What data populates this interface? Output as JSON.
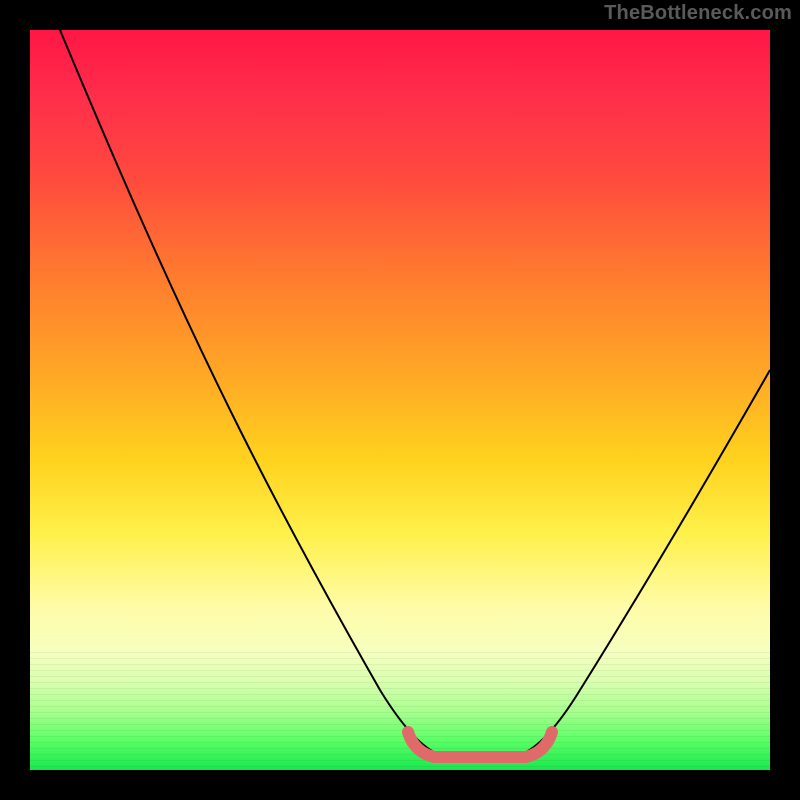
{
  "watermark": "TheBottleneck.com",
  "chart_data": {
    "type": "line",
    "title": "",
    "xlabel": "",
    "ylabel": "",
    "xlim": [
      0,
      100
    ],
    "ylim": [
      0,
      100
    ],
    "legend": false,
    "grid": false,
    "background_gradient": {
      "direction": "vertical",
      "stops": [
        {
          "pos": 0.0,
          "color": "#ff1744"
        },
        {
          "pos": 0.2,
          "color": "#ff4a3e"
        },
        {
          "pos": 0.46,
          "color": "#ffa626"
        },
        {
          "pos": 0.68,
          "color": "#fff04a"
        },
        {
          "pos": 0.88,
          "color": "#d9ffb0"
        },
        {
          "pos": 1.0,
          "color": "#18e84e"
        }
      ]
    },
    "series": [
      {
        "name": "bottleneck-curve",
        "color": "#000000",
        "stroke_width": 2,
        "x": [
          4,
          10,
          18,
          26,
          34,
          42,
          48,
          52,
          55,
          58,
          62,
          66,
          70,
          76,
          84,
          92,
          100
        ],
        "y": [
          100,
          88,
          74,
          60,
          46,
          32,
          18,
          8,
          3,
          1,
          1,
          3,
          8,
          18,
          32,
          46,
          60
        ]
      },
      {
        "name": "flat-zone-marker",
        "color": "#e06a6a",
        "stroke_width": 10,
        "notes": "thick salmon segment at the valley floor with small end arcs",
        "x": [
          52,
          55,
          58,
          62,
          66,
          68
        ],
        "y": [
          5,
          2,
          1,
          1,
          2,
          5
        ]
      }
    ],
    "annotations": []
  }
}
